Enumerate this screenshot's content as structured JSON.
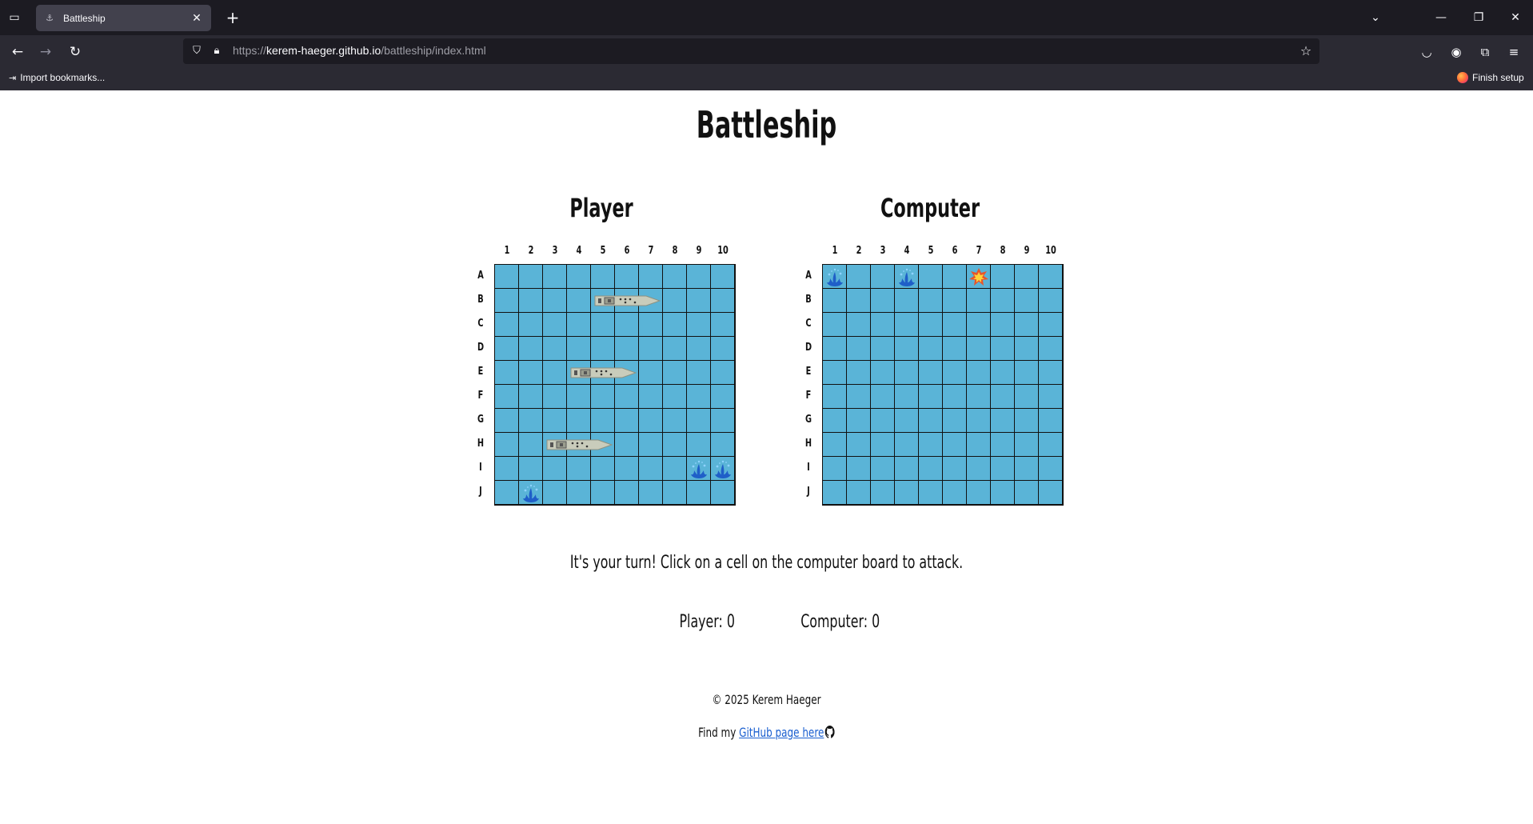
{
  "browser": {
    "tab_title": "Battleship",
    "url_prefix": "https://",
    "url_host": "kerem-haeger.github.io",
    "url_path": "/battleship/index.html",
    "bookmark_import": "Import bookmarks...",
    "bookmark_finish": "Finish setup"
  },
  "page": {
    "title": "Battleship",
    "player_label": "Player",
    "computer_label": "Computer",
    "status": "It's your turn! Click on a cell on the computer board to attack.",
    "player_score": "Player: 0",
    "computer_score": "Computer: 0",
    "copyright": "© 2025 Kerem Haeger",
    "find_prefix": "Find my ",
    "github_link": "GitHub page here"
  },
  "board": {
    "columns": [
      "1",
      "2",
      "3",
      "4",
      "5",
      "6",
      "7",
      "8",
      "9",
      "10"
    ],
    "rows": [
      "A",
      "B",
      "C",
      "D",
      "E",
      "F",
      "G",
      "H",
      "I",
      "J"
    ],
    "water_color": "#5ab4d7",
    "player_ships": [
      {
        "row": 1,
        "col": 4,
        "length": 3
      },
      {
        "row": 4,
        "col": 3,
        "length": 3
      },
      {
        "row": 7,
        "col": 2,
        "length": 3
      }
    ],
    "player_misses": [
      [
        8,
        8
      ],
      [
        8,
        9
      ],
      [
        9,
        1
      ]
    ],
    "player_hits": [],
    "computer_misses": [
      [
        0,
        0
      ],
      [
        0,
        3
      ]
    ],
    "computer_hits": [
      [
        0,
        6
      ]
    ]
  }
}
